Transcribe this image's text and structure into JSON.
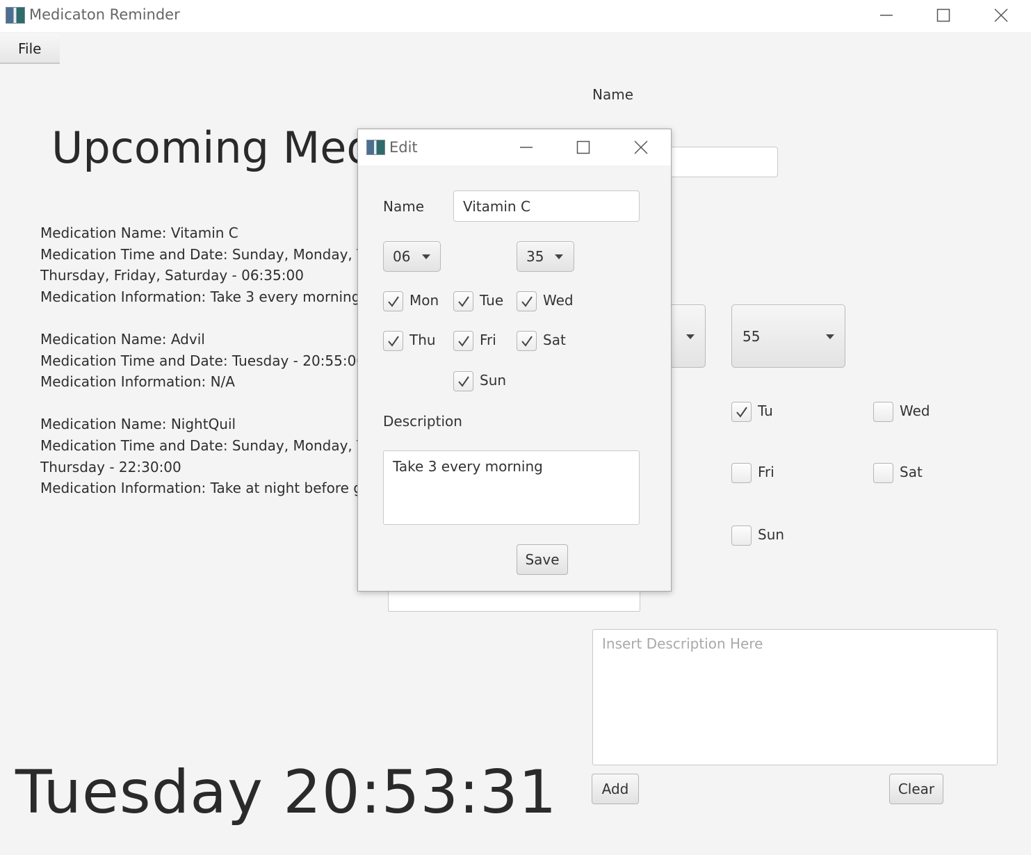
{
  "window": {
    "title": "Medicaton Reminder"
  },
  "menu": {
    "file": "File"
  },
  "main": {
    "heading": "Upcoming Medications",
    "entries": [
      [
        "Medication Name: Vitamin C",
        "Medication Time and Date: Sunday, Monday, Tuesday, Wednesday,",
        "Thursday, Friday, Saturday - 06:35:00",
        "Medication Information: Take 3 every morning"
      ],
      [
        "Medication Name: Advil",
        "Medication Time and Date: Tuesday - 20:55:00",
        "Medication Information: N/A"
      ],
      [
        "Medication Name: NightQuil",
        "Medication Time and Date: Sunday, Monday, Tuesday, Wednesday,",
        "Thursday - 22:30:00",
        "Medication Information: Take at night before going to bed"
      ]
    ],
    "clock": "Tuesday 20:53:31"
  },
  "add_form": {
    "name_label": "Name",
    "name_value": "",
    "hour": "",
    "minute": "55",
    "days": {
      "tue": {
        "label": "Tu",
        "checked": true
      },
      "wed": {
        "label": "Wed",
        "checked": false
      },
      "fri": {
        "label": "Fri",
        "checked": false
      },
      "sat": {
        "label": "Sat",
        "checked": false
      },
      "sun": {
        "label": "Sun",
        "checked": false
      }
    },
    "description_placeholder": "Insert Description Here",
    "add_label": "Add",
    "clear_label": "Clear"
  },
  "dialog": {
    "title": "Edit",
    "name_label": "Name",
    "name_value": "Vitamin C",
    "hour": "06",
    "minute": "35",
    "days": {
      "mon": {
        "label": "Mon",
        "checked": true
      },
      "tue": {
        "label": "Tue",
        "checked": true
      },
      "wed": {
        "label": "Wed",
        "checked": true
      },
      "thu": {
        "label": "Thu",
        "checked": true
      },
      "fri": {
        "label": "Fri",
        "checked": true
      },
      "sat": {
        "label": "Sat",
        "checked": true
      },
      "sun": {
        "label": "Sun",
        "checked": true
      }
    },
    "description_label": "Description",
    "description_value": "Take 3 every morning",
    "save_label": "Save"
  },
  "icons": {
    "minimize": "minimize-icon",
    "maximize": "maximize-icon",
    "close": "close-icon",
    "checkmark": "checkmark-icon",
    "dropdown": "chevron-down-icon"
  },
  "colors": {
    "background": "#f4f4f4",
    "titlebar": "#ffffff",
    "text": "#333333",
    "placeholder": "#a9a9a9"
  }
}
